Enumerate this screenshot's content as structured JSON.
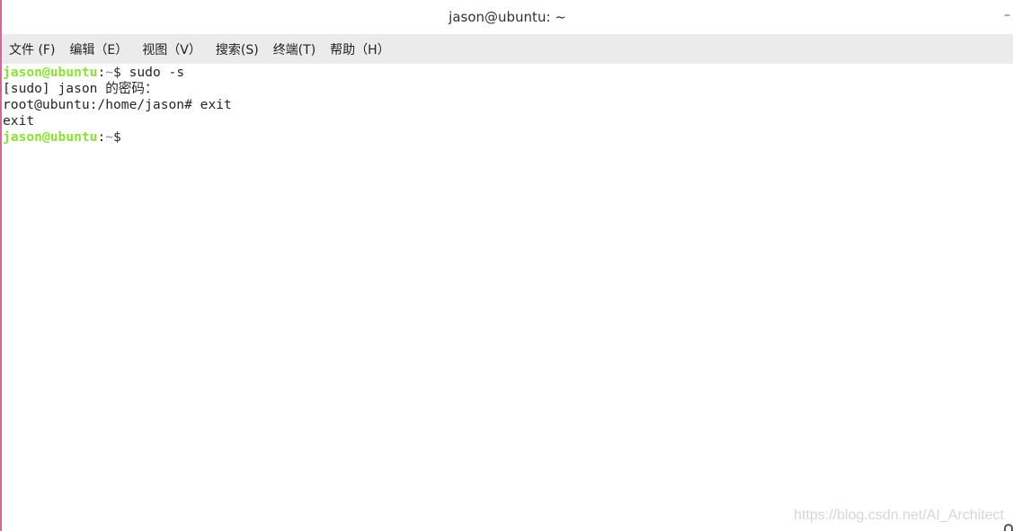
{
  "window": {
    "title": "jason@ubuntu: ~",
    "minimize_glyph": "–"
  },
  "menu": [
    {
      "label": "文件 (F)"
    },
    {
      "label": "编辑（E）"
    },
    {
      "label": "视图（V）"
    },
    {
      "label": "搜索(S)"
    },
    {
      "label": "终端(T)"
    },
    {
      "label": "帮助（H）"
    }
  ],
  "terminal": {
    "lines": [
      {
        "user": "jason@ubuntu",
        "sep": ":",
        "tilde": "~",
        "rest": "$ sudo -s"
      },
      {
        "text": "[sudo] jason 的密码："
      },
      {
        "text": "root@ubuntu:/home/jason# exit"
      },
      {
        "text": "exit"
      },
      {
        "user": "jason@ubuntu",
        "sep": ":",
        "tilde": "~",
        "rest": "$"
      }
    ]
  },
  "watermark": "https://blog.csdn.net/AI_Architect",
  "colors": {
    "prompt_user": "#8ae234",
    "menubar": "#ebebeb",
    "left_edge": "#e0609a"
  }
}
